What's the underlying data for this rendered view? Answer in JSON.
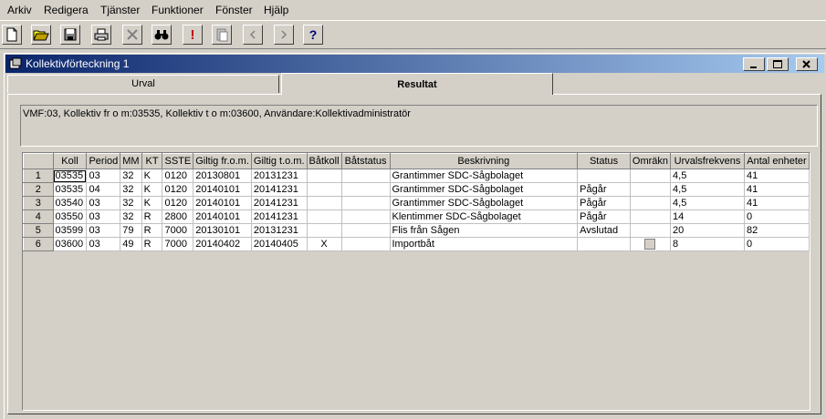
{
  "menu": [
    "Arkiv",
    "Redigera",
    "Tjänster",
    "Funktioner",
    "Fönster",
    "Hjälp"
  ],
  "toolbar": {
    "buttons": [
      "new-icon",
      "open-icon",
      "save-icon",
      "print-icon",
      "delete-icon",
      "find-icon",
      "alert-icon",
      "paste-icon",
      "prev-icon",
      "next-icon",
      "help-icon"
    ],
    "help_glyph": "?",
    "alert_glyph": "!"
  },
  "window": {
    "title": "Kollektivförteckning 1",
    "tabs": [
      "Urval",
      "Resultat"
    ]
  },
  "criteria": "VMF:03, Kollektiv fr o m:03535, Kollektiv t o m:03600, Användare:Kollektivadministratör",
  "grid": {
    "columns": [
      "Koll",
      "Period",
      "MM",
      "KT",
      "SSTE",
      "Giltig fr.o.m.",
      "Giltig t.o.m.",
      "Båtkoll",
      "Båtstatus",
      "Beskrivning",
      "Status",
      "Omräkn",
      "Urvalsfrekvens",
      "Antal enheter"
    ],
    "rows": [
      {
        "n": "1",
        "cells": [
          "03535",
          "03",
          "32",
          "K",
          "0120",
          "20130801",
          "20131231",
          "",
          "",
          "Grantimmer SDC-Sågbolaget",
          "",
          "",
          "4,5",
          "41"
        ]
      },
      {
        "n": "2",
        "cells": [
          "03535",
          "04",
          "32",
          "K",
          "0120",
          "20140101",
          "20141231",
          "",
          "",
          "Grantimmer SDC-Sågbolaget",
          "Pågår",
          "",
          "4,5",
          "41"
        ]
      },
      {
        "n": "3",
        "cells": [
          "03540",
          "03",
          "32",
          "K",
          "0120",
          "20140101",
          "20141231",
          "",
          "",
          "Grantimmer SDC-Sågbolaget",
          "Pågår",
          "",
          "4,5",
          "41"
        ]
      },
      {
        "n": "4",
        "cells": [
          "03550",
          "03",
          "32",
          "R",
          "2800",
          "20140101",
          "20141231",
          "",
          "",
          "Klentimmer SDC-Sågbolaget",
          "Pågår",
          "",
          "14",
          "0"
        ]
      },
      {
        "n": "5",
        "cells": [
          "03599",
          "03",
          "79",
          "R",
          "7000",
          "20130101",
          "20131231",
          "",
          "",
          "Flis från Sågen",
          "Avslutad",
          "",
          "20",
          "82"
        ]
      },
      {
        "n": "6",
        "cells": [
          "03600",
          "03",
          "49",
          "R",
          "7000",
          "20140402",
          "20140405",
          "X",
          "",
          "Importbåt",
          "",
          "",
          "8",
          "0"
        ]
      }
    ]
  }
}
